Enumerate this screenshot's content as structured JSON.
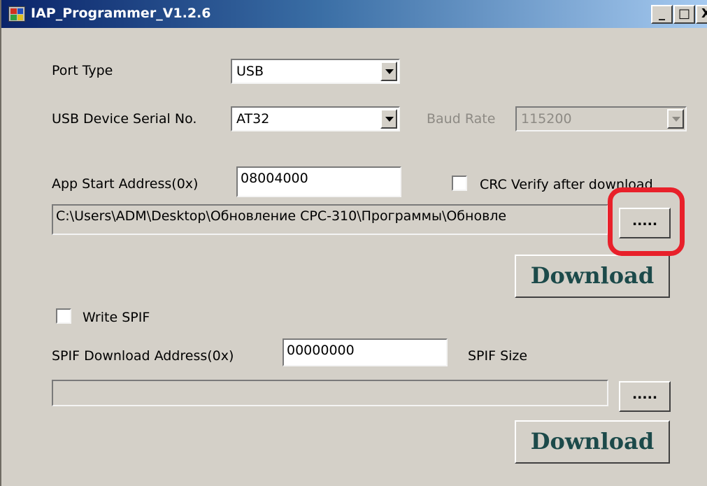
{
  "window": {
    "title": "IAP_Programmer_V1.2.6",
    "controls": {
      "minimize": "_",
      "maximize": "□",
      "close": "X"
    }
  },
  "port": {
    "port_type_label": "Port Type",
    "port_type_value": "USB",
    "serial_label": "USB Device Serial No.",
    "serial_value": "AT32",
    "baud_label": "Baud Rate",
    "baud_value": "115200"
  },
  "app": {
    "start_address_label": "App Start Address(0x)",
    "start_address_value": "08004000",
    "crc_label": "CRC Verify after download",
    "crc_checked": false,
    "file_path": "C:\\Users\\ADM\\Desktop\\Обновление CPC-310\\Программы\\Обновле",
    "browse_label": ".....",
    "download_label": "Download"
  },
  "spif": {
    "write_label": "Write SPIF",
    "write_checked": false,
    "address_label": "SPIF Download Address(0x)",
    "address_value": "00000000",
    "size_label": "SPIF Size",
    "file_path": "",
    "browse_label": ".....",
    "download_label": "Download"
  },
  "colors": {
    "face": "#d4d0c8",
    "title_start": "#0a246a",
    "title_end": "#a6caf0",
    "download_text": "#1c4a4a",
    "highlight": "#e8202a"
  }
}
